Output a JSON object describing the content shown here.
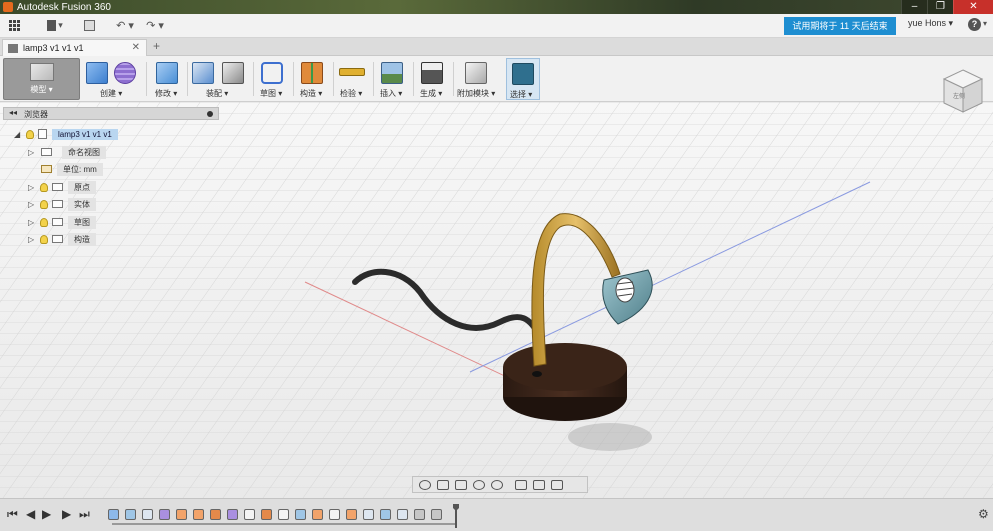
{
  "window": {
    "title": "Autodesk Fusion 360",
    "controls": [
      "–",
      "❐",
      "✕"
    ]
  },
  "qat": {
    "trial_banner": "试用期将于 11 天后结束",
    "user": "yue Hons",
    "help": "?",
    "caret": "▾",
    "file_label": "▾",
    "undo": "↶ ▾",
    "redo": "↷ ▾"
  },
  "tab": {
    "name": "lamp3 v1 v1 v1",
    "close": "✕",
    "new": "+"
  },
  "toolbar": {
    "workspace": "模型 ▾",
    "groups": [
      {
        "label": "创建 ▾",
        "colors": [
          "#4a8fd6",
          "#8d6fd0"
        ]
      },
      {
        "label": "修改 ▾",
        "colors": [
          "#4a8fd6"
        ]
      },
      {
        "label": "装配 ▾",
        "colors": [
          "#5a8fd0",
          "#6a6a6a"
        ]
      },
      {
        "label": "草图 ▾",
        "colors": [
          "#3d6fcf"
        ]
      },
      {
        "label": "构造 ▾",
        "colors": [
          "#d66b2a"
        ]
      },
      {
        "label": "检验 ▾",
        "colors": [
          "#d6a32a"
        ]
      },
      {
        "label": "插入 ▾",
        "colors": [
          "#5a85b6"
        ]
      },
      {
        "label": "生成 ▾",
        "colors": [
          "#555555"
        ]
      },
      {
        "label": "附加模块 ▾",
        "colors": [
          "#777777"
        ]
      },
      {
        "label": "选择 ▾",
        "colors": [
          "#2f6f8e"
        ]
      }
    ]
  },
  "browser": {
    "title": "浏览器",
    "arrows": "◂◂",
    "root": "lamp3 v1 v1 v1",
    "items": [
      {
        "label": "命名视图",
        "bulb": false
      },
      {
        "label": "单位: mm",
        "bulb": false,
        "unit": true
      },
      {
        "label": "原点",
        "bulb": true
      },
      {
        "label": "实体",
        "bulb": true
      },
      {
        "label": "草图",
        "bulb": true
      },
      {
        "label": "构造",
        "bulb": true
      }
    ]
  },
  "viewcube": {
    "label": "左侧"
  },
  "timeline": {
    "controls": [
      "⏮",
      "◀",
      "▶",
      "▶",
      "⏭"
    ],
    "gear": "⚙"
  }
}
